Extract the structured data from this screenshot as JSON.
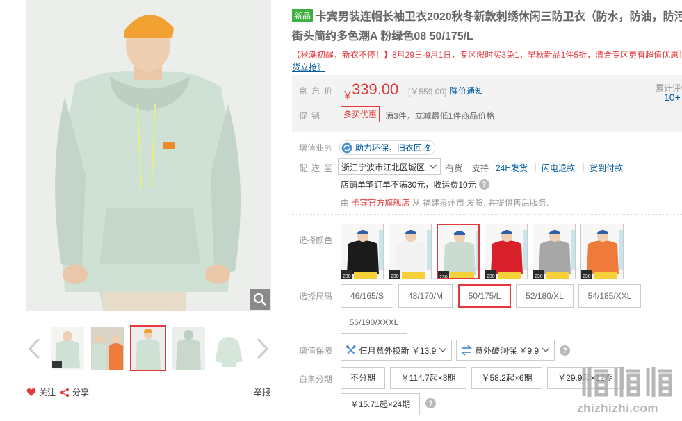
{
  "gallery": {
    "follow_label": "关注",
    "share_label": "分享",
    "report_label": "举报",
    "icons": {
      "zoom": "magnifier-icon",
      "follow": "heart-icon",
      "share": "share-icon",
      "prev": "chevron-left-icon",
      "next": "chevron-right-icon"
    },
    "thumbnails": [
      {
        "name": "thumb-1",
        "active": false
      },
      {
        "name": "thumb-2",
        "active": false
      },
      {
        "name": "thumb-3",
        "active": true
      },
      {
        "name": "thumb-4",
        "active": false
      },
      {
        "name": "thumb-5",
        "active": false
      }
    ]
  },
  "product": {
    "new_tag": "新品",
    "title_line1": "卡宾男装连帽长袖卫衣2020秋冬新款刺绣休闲三防卫衣（防水，防油，防污）",
    "title_line2": "街头简约多色潮A 粉绿色08 50/175/L",
    "promo_text": "【秋潮初醒，新衣不停！】8月29日-9月1日，专区限时买3免1，早秋新品1件5折，清合专区更有超值优惠！",
    "promo_link": "货立抢》"
  },
  "price": {
    "label": "京东价",
    "currency": "￥",
    "value": "339.00",
    "original": "￥559.00",
    "notify_label": "降价通知",
    "promo_label": "促销",
    "promo_badge": "多买优惠",
    "promo_desc": "满3件，立减最低1件商品价格",
    "review_label": "累计评价",
    "review_count": "10+"
  },
  "service": {
    "value_label": "增值业务",
    "value_chip": "助力环保，旧衣回收",
    "delivery_label": "配送至",
    "region": "浙江宁波市江北区城区",
    "stock": "有货",
    "support_label": "支持",
    "delivery_24h": "24H发货",
    "flash_refund": "闪电退款",
    "cod": "货到付款",
    "shipping_fee": "店铺单笔订单不满30元，收运费10元",
    "seller_prefix": "由",
    "seller_store": "卡宾官方旗舰店",
    "seller_suffix": "从 福建泉州市 发货, 并提供售后服务."
  },
  "colors": {
    "label": "选择颜色",
    "swatch_caption": "230",
    "items": [
      {
        "name": "black",
        "hex": "#1b1b1b",
        "selected": false
      },
      {
        "name": "white",
        "hex": "#f2f2f2",
        "selected": false
      },
      {
        "name": "mint",
        "hex": "#c9dccf",
        "selected": true
      },
      {
        "name": "red",
        "hex": "#d8202a",
        "selected": false
      },
      {
        "name": "grey",
        "hex": "#a7a7a7",
        "selected": false
      },
      {
        "name": "orange",
        "hex": "#ee7b3a",
        "selected": false
      }
    ]
  },
  "sizes": {
    "label": "选择尺码",
    "items": [
      {
        "label": "46/165/S",
        "selected": false
      },
      {
        "label": "48/170/M",
        "selected": false
      },
      {
        "label": "50/175/L",
        "selected": true
      },
      {
        "label": "52/180/XL",
        "selected": false
      },
      {
        "label": "54/185/XXL",
        "selected": false
      },
      {
        "label": "56/190/XXXL",
        "selected": false
      }
    ]
  },
  "insurance": {
    "label": "增值保障",
    "option1": "仨月意外换新 ￥13.9",
    "option2": "意外破洞保 ￥9.9"
  },
  "installment": {
    "label": "白条分期",
    "items": [
      "不分期",
      "￥114.7起×3期",
      "￥58.2起×6期",
      "￥29.9起×12期",
      "￥15.71起×24期"
    ]
  },
  "watermark": {
    "text": "zhizhizhi.com",
    "logo": "值值值"
  },
  "colors_theme": {
    "accent": "#e4393c",
    "link": "#005aa0",
    "new_tag": "#3db03f"
  }
}
